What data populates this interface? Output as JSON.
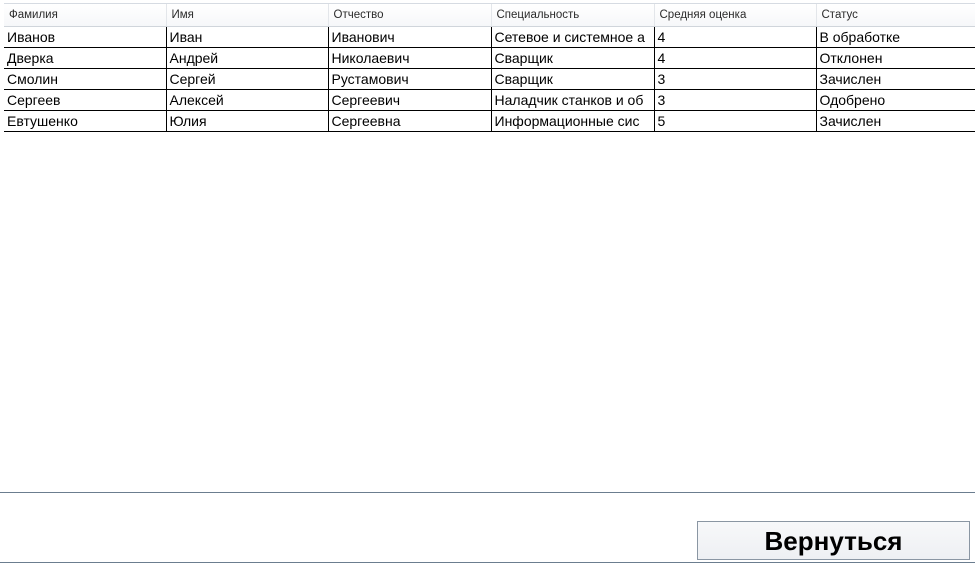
{
  "table": {
    "columns": [
      "Фамилия",
      "Имя",
      "Отчество",
      "Специальность",
      "Средняя оценка",
      "Статус"
    ],
    "rows": [
      [
        "Иванов",
        "Иван",
        "Иванович",
        "Сетевое и системное а",
        "4",
        "В обработке"
      ],
      [
        "Дверка",
        "Андрей",
        "Николаевич",
        "Сварщик",
        "4",
        "Отклонен"
      ],
      [
        "Смолин",
        "Сергей",
        "Рустамович",
        "Сварщик",
        "3",
        "Зачислен"
      ],
      [
        "Сергеев",
        "Алексей",
        "Сергеевич",
        "Наладчик станков и об",
        "3",
        "Одобрено"
      ],
      [
        "Евтушенко",
        "Юлия",
        "Сергеевна",
        "Информационные сис",
        "5",
        "Зачислен"
      ]
    ]
  },
  "back_button": {
    "label": "Вернуться"
  }
}
